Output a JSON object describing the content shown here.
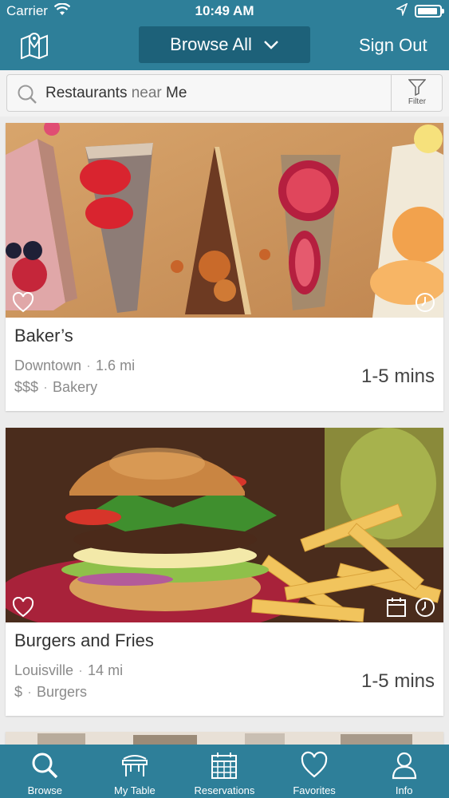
{
  "status_bar": {
    "carrier": "Carrier",
    "time": "10:49 AM"
  },
  "nav": {
    "browse_label": "Browse All",
    "signout_label": "Sign Out"
  },
  "search": {
    "term": "Restaurants",
    "near_word": "near",
    "location": "Me",
    "filter_label": "Filter"
  },
  "listings": [
    {
      "name": "Baker’s",
      "area": "Downtown",
      "distance": "1.6 mi",
      "price": "$$$",
      "category": "Bakery",
      "eta": "1-5 mins"
    },
    {
      "name": "Burgers and Fries",
      "area": "Louisville",
      "distance": "14 mi",
      "price": "$",
      "category": "Burgers",
      "eta": "1-5 mins"
    }
  ],
  "tabs": [
    {
      "label": "Browse",
      "icon": "search-icon"
    },
    {
      "label": "My Table",
      "icon": "table-icon"
    },
    {
      "label": "Reservations",
      "icon": "calendar-icon"
    },
    {
      "label": "Favorites",
      "icon": "heart-icon"
    },
    {
      "label": "Info",
      "icon": "person-icon"
    }
  ],
  "colors": {
    "brand": "#2e7f99",
    "brand_dark": "#1d6179"
  }
}
